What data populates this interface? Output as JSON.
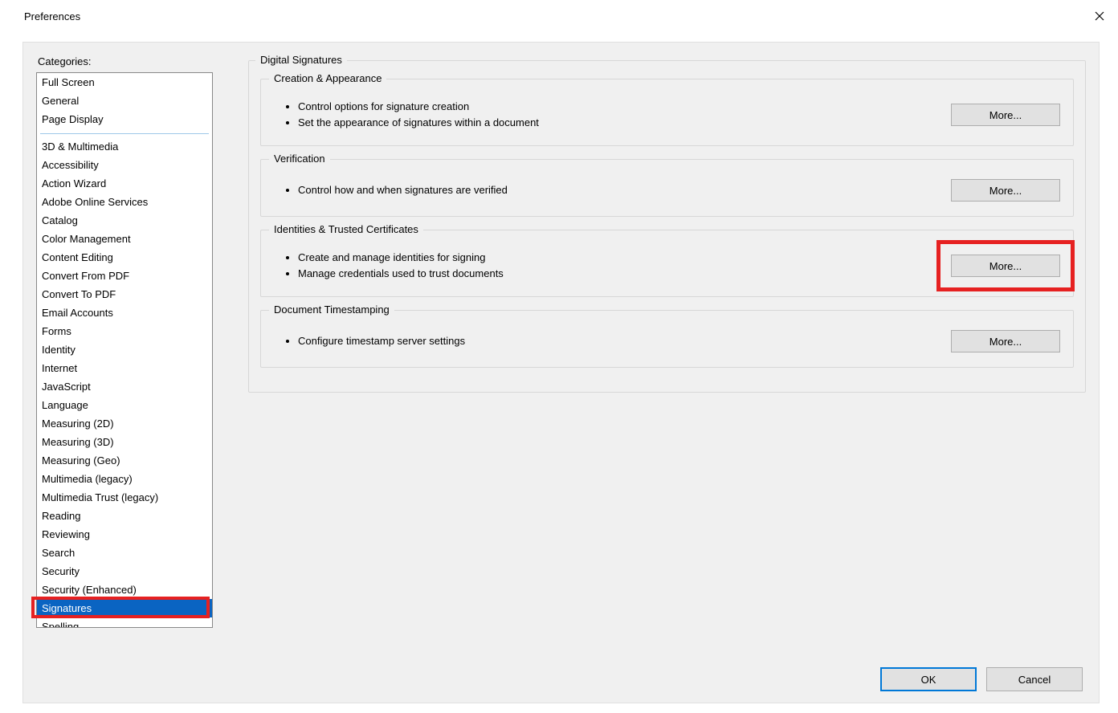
{
  "window": {
    "title": "Preferences"
  },
  "sidebar": {
    "label": "Categories:",
    "group1": [
      "Full Screen",
      "General",
      "Page Display"
    ],
    "group2": [
      "3D & Multimedia",
      "Accessibility",
      "Action Wizard",
      "Adobe Online Services",
      "Catalog",
      "Color Management",
      "Content Editing",
      "Convert From PDF",
      "Convert To PDF",
      "Email Accounts",
      "Forms",
      "Identity",
      "Internet",
      "JavaScript",
      "Language",
      "Measuring (2D)",
      "Measuring (3D)",
      "Measuring (Geo)",
      "Multimedia (legacy)",
      "Multimedia Trust (legacy)",
      "Reading",
      "Reviewing",
      "Search",
      "Security",
      "Security (Enhanced)",
      "Signatures",
      "Spelling"
    ],
    "selected": "Signatures"
  },
  "main": {
    "groupTitle": "Digital Signatures",
    "sections": [
      {
        "title": "Creation & Appearance",
        "bullets": [
          "Control options for signature creation",
          "Set the appearance of signatures within a document"
        ],
        "button": "More..."
      },
      {
        "title": "Verification",
        "bullets": [
          "Control how and when signatures are verified"
        ],
        "button": "More..."
      },
      {
        "title": "Identities & Trusted Certificates",
        "bullets": [
          "Create and manage identities for signing",
          "Manage credentials used to trust documents"
        ],
        "button": "More..."
      },
      {
        "title": "Document Timestamping",
        "bullets": [
          "Configure timestamp server settings"
        ],
        "button": "More..."
      }
    ]
  },
  "footer": {
    "ok": "OK",
    "cancel": "Cancel"
  }
}
